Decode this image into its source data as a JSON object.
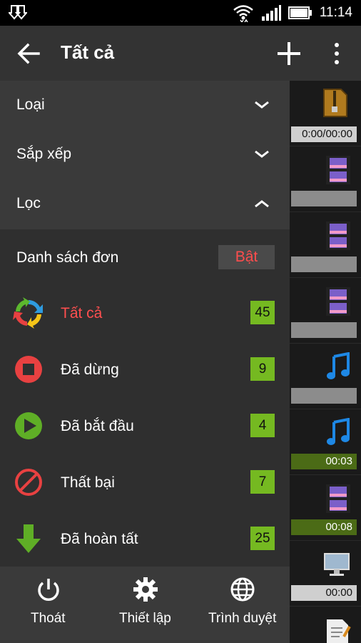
{
  "status_bar": {
    "time": "11:14",
    "download_icon": "download-icon",
    "wifi_icon": "wifi-icon",
    "signal_icon": "signal-icon",
    "battery_icon": "battery-icon"
  },
  "action_bar": {
    "title": "Tất cả",
    "back_icon": "arrow-back-icon",
    "add_icon": "plus-icon",
    "more_icon": "more-vert-icon"
  },
  "drawer": {
    "sections": [
      {
        "label": "Loại",
        "expanded": false
      },
      {
        "label": "Sắp xếp",
        "expanded": false
      },
      {
        "label": "Lọc",
        "expanded": true
      }
    ],
    "single_list": {
      "label": "Danh sách đơn",
      "toggle": "Bật"
    },
    "filters": [
      {
        "label": "Tất cả",
        "count": "45",
        "icon": "all-cycle-icon",
        "active": true
      },
      {
        "label": "Đã dừng",
        "count": "9",
        "icon": "stop-icon",
        "active": false
      },
      {
        "label": "Đã bắt đầu",
        "count": "4",
        "icon": "play-icon",
        "active": false
      },
      {
        "label": "Thất bại",
        "count": "7",
        "icon": "failed-icon",
        "active": false
      },
      {
        "label": "Đã hoàn tất",
        "count": "25",
        "icon": "download-complete-icon",
        "active": false
      }
    ],
    "bottom_buttons": [
      {
        "label": "Thoát",
        "icon": "power-icon"
      },
      {
        "label": "Thiết lập",
        "icon": "gear-icon"
      },
      {
        "label": "Trình duyệt",
        "icon": "globe-icon"
      }
    ]
  },
  "background_list": {
    "rows": [
      {
        "icon": "archive-file-icon",
        "bar_text": "0:00/00:00"
      },
      {
        "icon": "video-file-icon",
        "bar_text": ""
      },
      {
        "icon": "video-file-icon",
        "bar_text": ""
      },
      {
        "icon": "video-file-icon",
        "bar_text": ""
      },
      {
        "icon": "music-file-icon",
        "bar_text": ""
      },
      {
        "icon": "music-file-icon",
        "bar_text": "00:03"
      },
      {
        "icon": "video-file-icon",
        "bar_text": "00:08"
      },
      {
        "icon": "monitor-icon",
        "bar_text": "00:00"
      },
      {
        "icon": "document-icon",
        "bar_text": ""
      }
    ]
  },
  "colors": {
    "accent_red": "#ff4f4f",
    "count_green": "#75b921",
    "drawer_bg": "#3a3a3a",
    "panel_bg": "#2f2f2f"
  }
}
